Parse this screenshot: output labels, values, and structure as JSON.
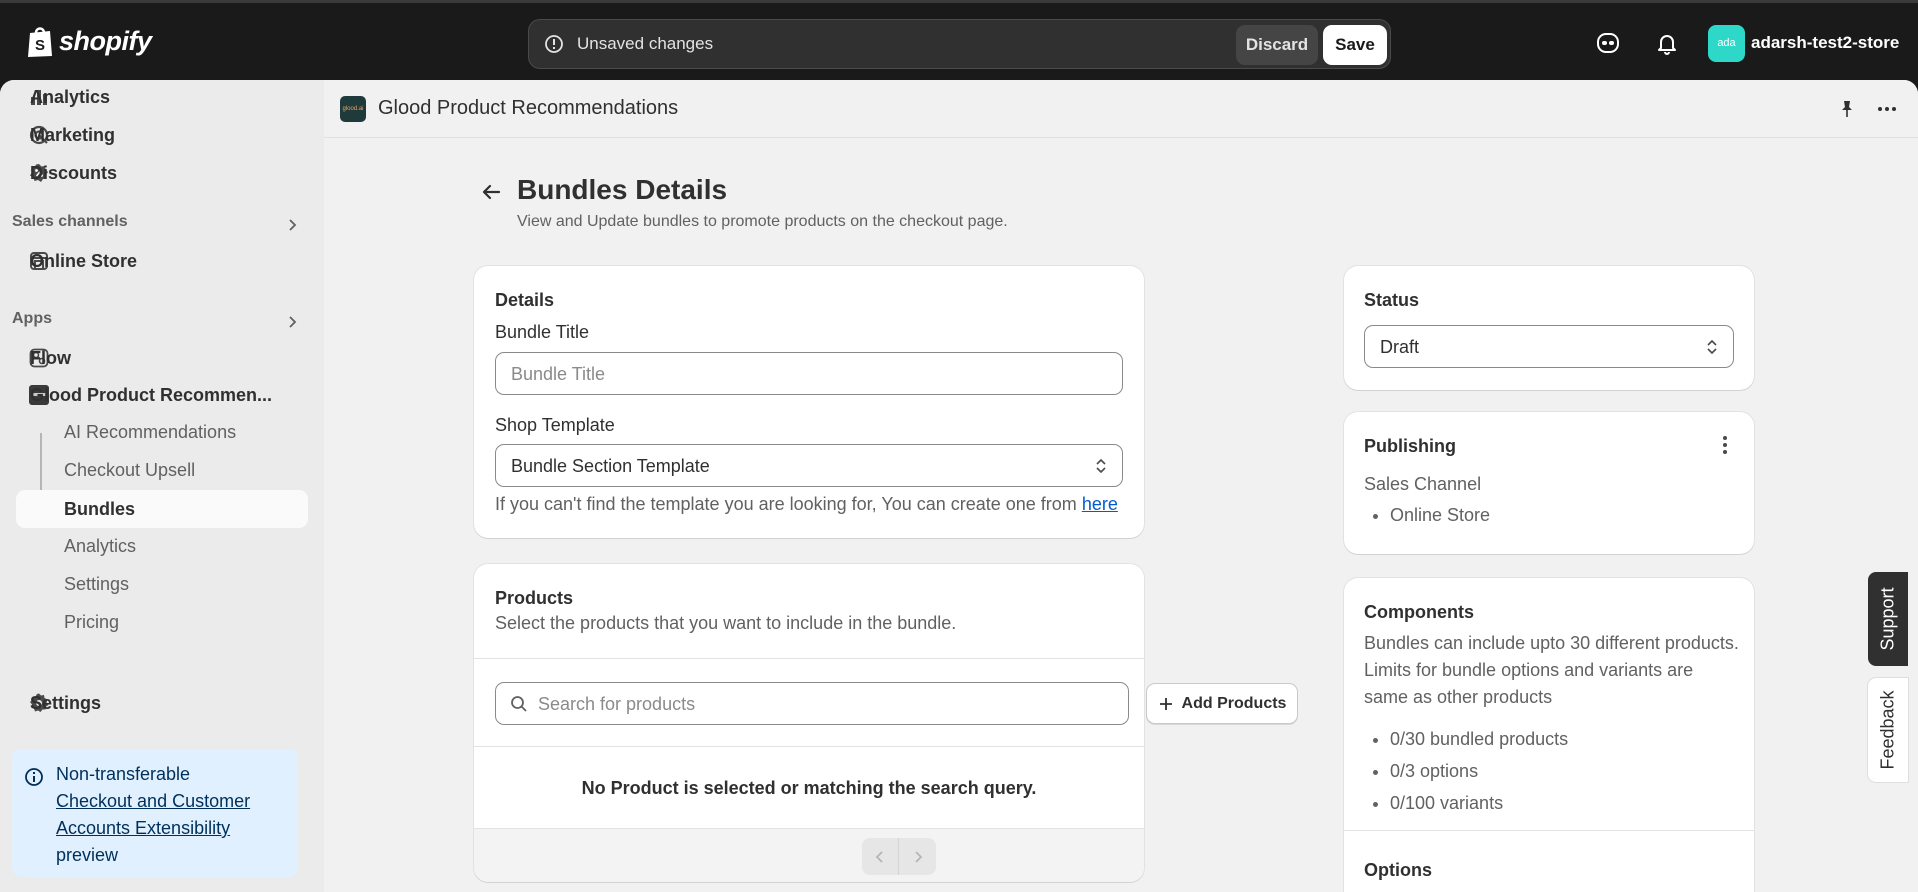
{
  "topbar": {
    "brand": "shopify",
    "unsaved_text": "Unsaved changes",
    "discard_label": "Discard",
    "save_label": "Save",
    "avatar_initials": "ada",
    "store_name": "adarsh-test2-store",
    "avatar_color": "#2dd8c8"
  },
  "sidebar": {
    "items_top": [
      {
        "label": "Analytics",
        "icon": "bar-chart-icon"
      },
      {
        "label": "Marketing",
        "icon": "target-icon"
      },
      {
        "label": "Discounts",
        "icon": "discount-icon"
      }
    ],
    "sales_channels_label": "Sales channels",
    "online_store_label": "Online Store",
    "apps_label": "Apps",
    "flow_label": "Flow",
    "app_label": "Glood Product Recommen...",
    "sub_items": [
      {
        "label": "AI Recommendations"
      },
      {
        "label": "Checkout Upsell"
      },
      {
        "label": "Bundles"
      },
      {
        "label": "Analytics"
      },
      {
        "label": "Settings"
      },
      {
        "label": "Pricing"
      }
    ],
    "settings_label": "Settings",
    "banner": {
      "prefix": "Non-transferable",
      "link": "Checkout and Customer Accounts Extensibility",
      "suffix": "preview"
    }
  },
  "app_header": {
    "title": "Glood Product Recommendations",
    "logo_text": "glood.ai"
  },
  "page": {
    "title": "Bundles Details",
    "subtitle": "View and Update bundles to promote products on the checkout page."
  },
  "details_card": {
    "title": "Details",
    "bundle_title_label": "Bundle Title",
    "bundle_title_placeholder": "Bundle Title",
    "bundle_title_value": "",
    "shop_template_label": "Shop Template",
    "shop_template_value": "Bundle Section Template",
    "help_text": "If you can't find the template you are looking for, You can create one from ",
    "help_link": "here"
  },
  "products_card": {
    "title": "Products",
    "subtitle": "Select the products that you want to include in the bundle.",
    "search_placeholder": "Search for products",
    "add_button": "Add Products",
    "empty_text": "No Product is selected or matching the search query."
  },
  "status_card": {
    "title": "Status",
    "value": "Draft"
  },
  "publishing_card": {
    "title": "Publishing",
    "channel_label": "Sales Channel",
    "channels": [
      "Online Store"
    ]
  },
  "components_card": {
    "title": "Components",
    "description": "Bundles can include upto 30 different products. Limits for bundle options and variants are same as other products",
    "limits": [
      "0/30 bundled products",
      "0/3 options",
      "0/100 variants"
    ],
    "options_title": "Options"
  },
  "side_tabs": {
    "support": "Support",
    "feedback": "Feedback"
  }
}
